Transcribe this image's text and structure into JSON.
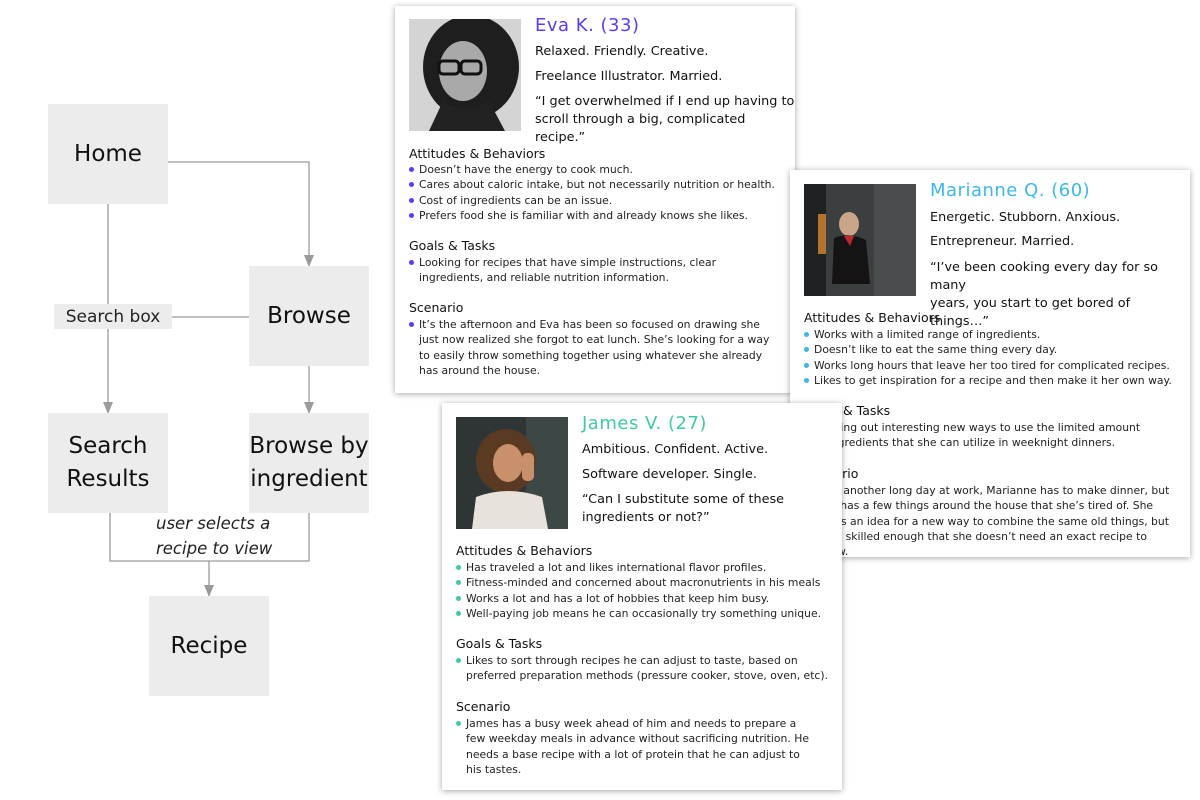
{
  "flowchart": {
    "nodes": {
      "home": "Home",
      "browse": "Browse",
      "search_results_line1": "Search",
      "search_results_line2": "Results",
      "browse_by_ingredient_line1": "Browse by",
      "browse_by_ingredient_line2": "ingredient",
      "recipe": "Recipe"
    },
    "edge_labels": {
      "search_box": "Search box",
      "user_selects_line1": "user selects a",
      "user_selects_line2": "recipe to view"
    }
  },
  "personas": {
    "eva": {
      "name": "Eva K. (33)",
      "traits": "Relaxed. Friendly. Creative.",
      "occupation": "Freelance Illustrator. Married.",
      "quote_line1": "“I get overwhelmed if I end up having to",
      "quote_line2": "scroll through a big, complicated recipe.”",
      "attitudes_heading": "Attitudes & Behaviors",
      "attitudes": [
        "Doesn’t have the energy to cook much.",
        "Cares about caloric intake, but not necessarily nutrition or health.",
        "Cost of ingredients can be an issue.",
        "Prefers food she is familiar with and already knows she likes."
      ],
      "goals_heading": "Goals & Tasks",
      "goals": [
        "Looking for recipes that have simple instructions, clear ingredients, and reliable nutrition information."
      ],
      "scenario_heading": "Scenario",
      "scenario": [
        "It’s the afternoon and Eva has been so focused on drawing she just now realized she forgot to eat lunch. She’s looking for a way to easily throw something together using whatever she already has around the house."
      ],
      "accent": "#5b3cf5"
    },
    "marianne": {
      "name": "Marianne Q. (60)",
      "traits": "Energetic. Stubborn. Anxious.",
      "occupation": "Entrepreneur. Married.",
      "quote_line1": "“I’ve been cooking every day for so many",
      "quote_line2": "years, you start to get bored of things…”",
      "attitudes_heading": "Attitudes & Behaviors",
      "attitudes": [
        "Works with a limited range of ingredients.",
        "Doesn’t like to eat the same thing every day.",
        "Works long hours that leave her too tired for complicated recipes.",
        "Likes to get inspiration for a recipe and then make it her own way."
      ],
      "goals_heading": "Goals & Tasks",
      "goals": [
        "Seeking out interesting new ways to use the limited amount of ingredients that she can utilize in weeknight dinners."
      ],
      "scenario_heading": "Scenario",
      "scenario": [
        "After another long day at work, Marianne has to make dinner, but only has a few things around the house that she’s tired of. She needs an idea for a new way to combine the same old things, but she’s skilled enough that she doesn’t need an exact recipe to follow."
      ],
      "accent": "#3bb8e8"
    },
    "james": {
      "name": "James V. (27)",
      "traits": "Ambitious. Confident. Active.",
      "occupation": "Software developer. Single.",
      "quote_line1": "“Can I substitute some of these",
      "quote_line2": "ingredients or not?”",
      "attitudes_heading": "Attitudes & Behaviors",
      "attitudes": [
        "Has traveled a lot and likes international flavor profiles.",
        "Fitness-minded and concerned about macronutrients in his meals",
        "Works a lot and has a lot of hobbies that keep him busy.",
        "Well-paying job means he can occasionally try something unique."
      ],
      "goals_heading": "Goals & Tasks",
      "goals": [
        "Likes to sort through recipes he can adjust to taste, based on preferred preparation methods (pressure cooker, stove, oven, etc)."
      ],
      "scenario_heading": "Scenario",
      "scenario": [
        "James has a busy week ahead of him and needs to prepare a few weekday meals in advance without sacrificing nutrition. He needs a base recipe with a lot of protein that he can adjust to his tastes."
      ],
      "accent": "#3ec9a8"
    }
  }
}
